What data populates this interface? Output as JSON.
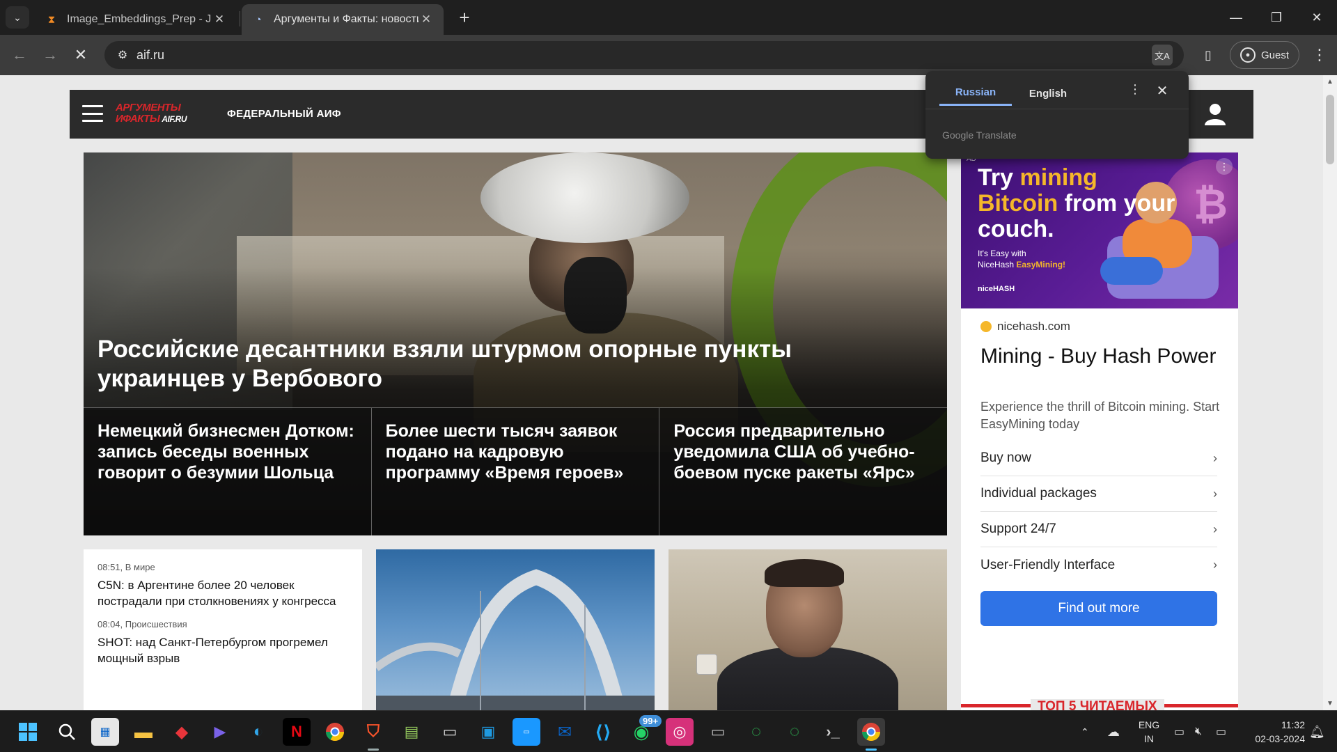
{
  "browser": {
    "tabs": [
      {
        "title": "Image_Embeddings_Prep - Jupy",
        "active": false,
        "icon": "hourglass-icon"
      },
      {
        "title": "Аргументы и Факты: новости Р",
        "active": true,
        "icon": "loading-spinner-icon"
      }
    ],
    "url": "aif.ru",
    "profile_label": "Guest"
  },
  "site": {
    "logo_line1": "АРГУМЕНТЫ",
    "logo_line2": "ИФАКТЫ",
    "logo_domain": "AIF.RU",
    "section_label": "ФЕДЕРАЛЬНЫЙ АИФ"
  },
  "hero": {
    "title": "Российские десантники взяли штурмом опорные пункты украинцев у Вербового",
    "sub_stories": [
      "Немецкий бизнесмен Дотком: запись беседы военных говорит о безумии Шольца",
      "Более шести тысяч заявок подано на кадровую программу «Время героев»",
      "Россия предварительно уведомила США об учебно-боевом пуске ракеты «Ярс»"
    ]
  },
  "news_list": [
    {
      "meta": "08:51, В мире",
      "text": "C5N: в Аргентине более 20 человек пострадали при столкновениях у конгресса"
    },
    {
      "meta": "08:04, Происшествия",
      "text": "SHOT: над Санкт-Петербургом прогремел мощный взрыв"
    }
  ],
  "ad": {
    "label": "AD",
    "headline_part1": "Try ",
    "headline_part2": "mining",
    "headline_part3": "Bitcoin",
    "headline_part4": " from your couch.",
    "sub_line1": "It's Easy with",
    "sub_line2_prefix": "NiceHash ",
    "sub_line2_brand": "EasyMining!",
    "brand_small": "niceHASH",
    "domain": "nicehash.com",
    "title": "Mining - Buy Hash Power",
    "description": "Experience the thrill of Bitcoin mining. Start EasyMining today",
    "links": [
      "Buy now",
      "Individual packages",
      "Support 24/7",
      "User-Friendly Interface"
    ],
    "cta": "Find out more"
  },
  "top5_heading": "ТОП 5 ЧИТАЕМЫХ",
  "translate_popup": {
    "tab_source": "Russian",
    "tab_target": "English",
    "brand": "Google Translate"
  },
  "taskbar": {
    "whatsapp_badge": "99+",
    "lang_line1": "ENG",
    "lang_line2": "IN",
    "time": "11:32",
    "date": "02-03-2024"
  }
}
